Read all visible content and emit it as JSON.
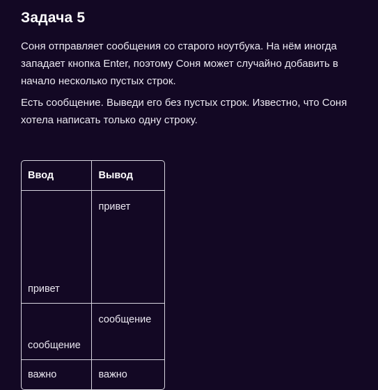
{
  "task": {
    "title": "Задача 5",
    "paragraphs": [
      "Соня отправляет сообщения со старого ноутбука. На нём иногда западает кнопка Enter, поэтому Соня может случайно добавить в начало несколько пустых строк.",
      "Есть сообщение. Выведи его без пустых строк. Известно, что Соня хотела написать только одну строку."
    ]
  },
  "table": {
    "headers": {
      "input": "Ввод",
      "output": "Вывод"
    },
    "rows": [
      {
        "input": "привет",
        "output": "привет"
      },
      {
        "input": "сообщение",
        "output": "сообщение"
      },
      {
        "input": "важно",
        "output": "важно"
      }
    ]
  }
}
